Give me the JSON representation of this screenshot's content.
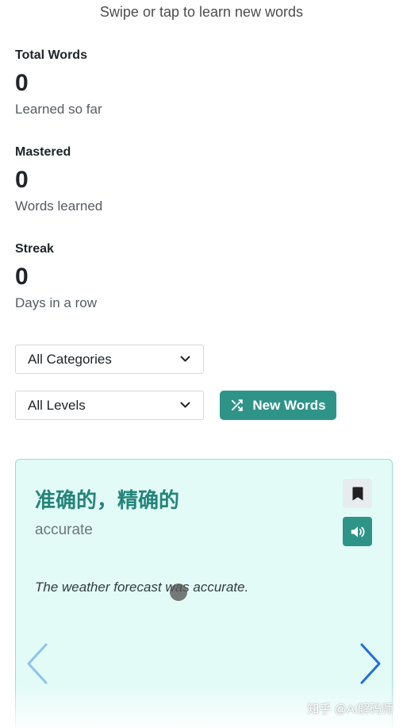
{
  "header": {
    "subtitle": "Swipe or tap to learn new words"
  },
  "stats": [
    {
      "label": "Total Words",
      "value": "0",
      "caption": "Learned so far"
    },
    {
      "label": "Mastered",
      "value": "0",
      "caption": "Words learned"
    },
    {
      "label": "Streak",
      "value": "0",
      "caption": "Days in a row"
    }
  ],
  "filters": {
    "category": {
      "selected": "All Categories"
    },
    "level": {
      "selected": "All Levels"
    },
    "new_words_label": "New Words"
  },
  "card": {
    "word": "准确的，精确的",
    "translation": "accurate",
    "example": "The weather forecast was accurate."
  },
  "icons": {
    "dropdown": "chevron-down-icon",
    "new_words": "shuffle-icon",
    "bookmark": "bookmark-icon",
    "pronounce": "speaker-icon",
    "previous": "chevron-left-icon",
    "next": "chevron-right-icon"
  },
  "colors": {
    "accent": "#2f9488",
    "card_background": "#e2fbf7",
    "card_border": "#93e0d5",
    "word_text": "#24857a",
    "chevron_prev": "#8cc4ea",
    "chevron_next": "#1f6fdb"
  },
  "watermark": "知乎 @AI解码师"
}
